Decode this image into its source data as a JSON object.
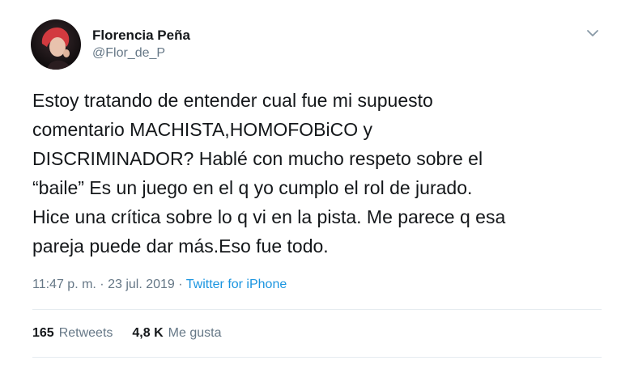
{
  "author": {
    "display_name": "Florencia Peña",
    "handle": "@Flor_de_P"
  },
  "tweet": {
    "text": "Estoy tratando de entender cual fue mi supuesto\ncomentario MACHISTA,HOMOFOBiCO y\nDISCRIMINADOR? Hablé con mucho respeto sobre el\n“baile” Es un juego en el q yo cumplo el rol de jurado.\nHice una crítica sobre lo q vi en la pista. Me parece q esa\npareja puede dar más.Eso fue todo."
  },
  "meta": {
    "timestamp": "11:47 p. m. · 23 jul. 2019",
    "separator": " · ",
    "source": "Twitter for iPhone"
  },
  "stats": {
    "retweets_count": "165",
    "retweets_label": "Retweets",
    "likes_count": "4,8 K",
    "likes_label": "Me gusta"
  },
  "icons": {
    "menu": "chevron-down-icon",
    "avatar": "avatar"
  },
  "colors": {
    "text": "#14171a",
    "secondary": "#657786",
    "link": "#1b95e0",
    "divider": "#e6ecf0"
  }
}
